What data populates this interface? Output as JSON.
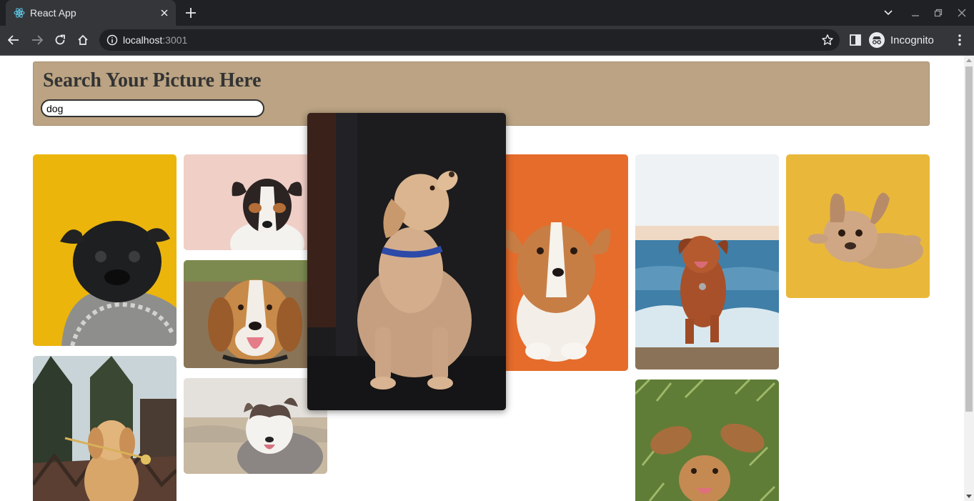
{
  "browser": {
    "tab": {
      "title": "React App",
      "favicon": "react-icon"
    },
    "url": {
      "host": "localhost",
      "port": ":3001"
    },
    "profile_label": "Incognito",
    "icons": [
      "back-icon",
      "forward-icon",
      "reload-icon",
      "home-icon",
      "info-icon",
      "star-icon",
      "side-panel-icon",
      "incognito-icon",
      "menu-icon",
      "close-icon",
      "plus-icon",
      "chevron-down-icon",
      "minimize-icon",
      "restore-icon",
      "window-close-icon"
    ]
  },
  "page": {
    "heading": "Search Your Picture Here",
    "search": {
      "value": "dog",
      "placeholder": ""
    },
    "header_color": "#bba383",
    "images": [
      {
        "subject": "black pug in knit sweater",
        "background": "#eab308"
      },
      {
        "subject": "golden retriever puppy holding flower",
        "background": "#c8d3d6"
      },
      {
        "subject": "jack russell terrier",
        "background": "#f1cfc7"
      },
      {
        "subject": "smiling beagle",
        "background": "#7d8f4f"
      },
      {
        "subject": "australian shepherd on beach",
        "background": "#dedad3"
      },
      {
        "subject": "labrador puppy with blue collar (enlarged)",
        "background": "#1b1a1c"
      },
      {
        "subject": "corgi puppy",
        "background": "#e76d2e"
      },
      {
        "subject": "toller dog running in waves",
        "background": "#4f8fb3"
      },
      {
        "subject": "spaniel lying in grass",
        "background": "#5d7d34"
      },
      {
        "subject": "french bulldog lying down",
        "background": "#e8b73a"
      }
    ]
  }
}
